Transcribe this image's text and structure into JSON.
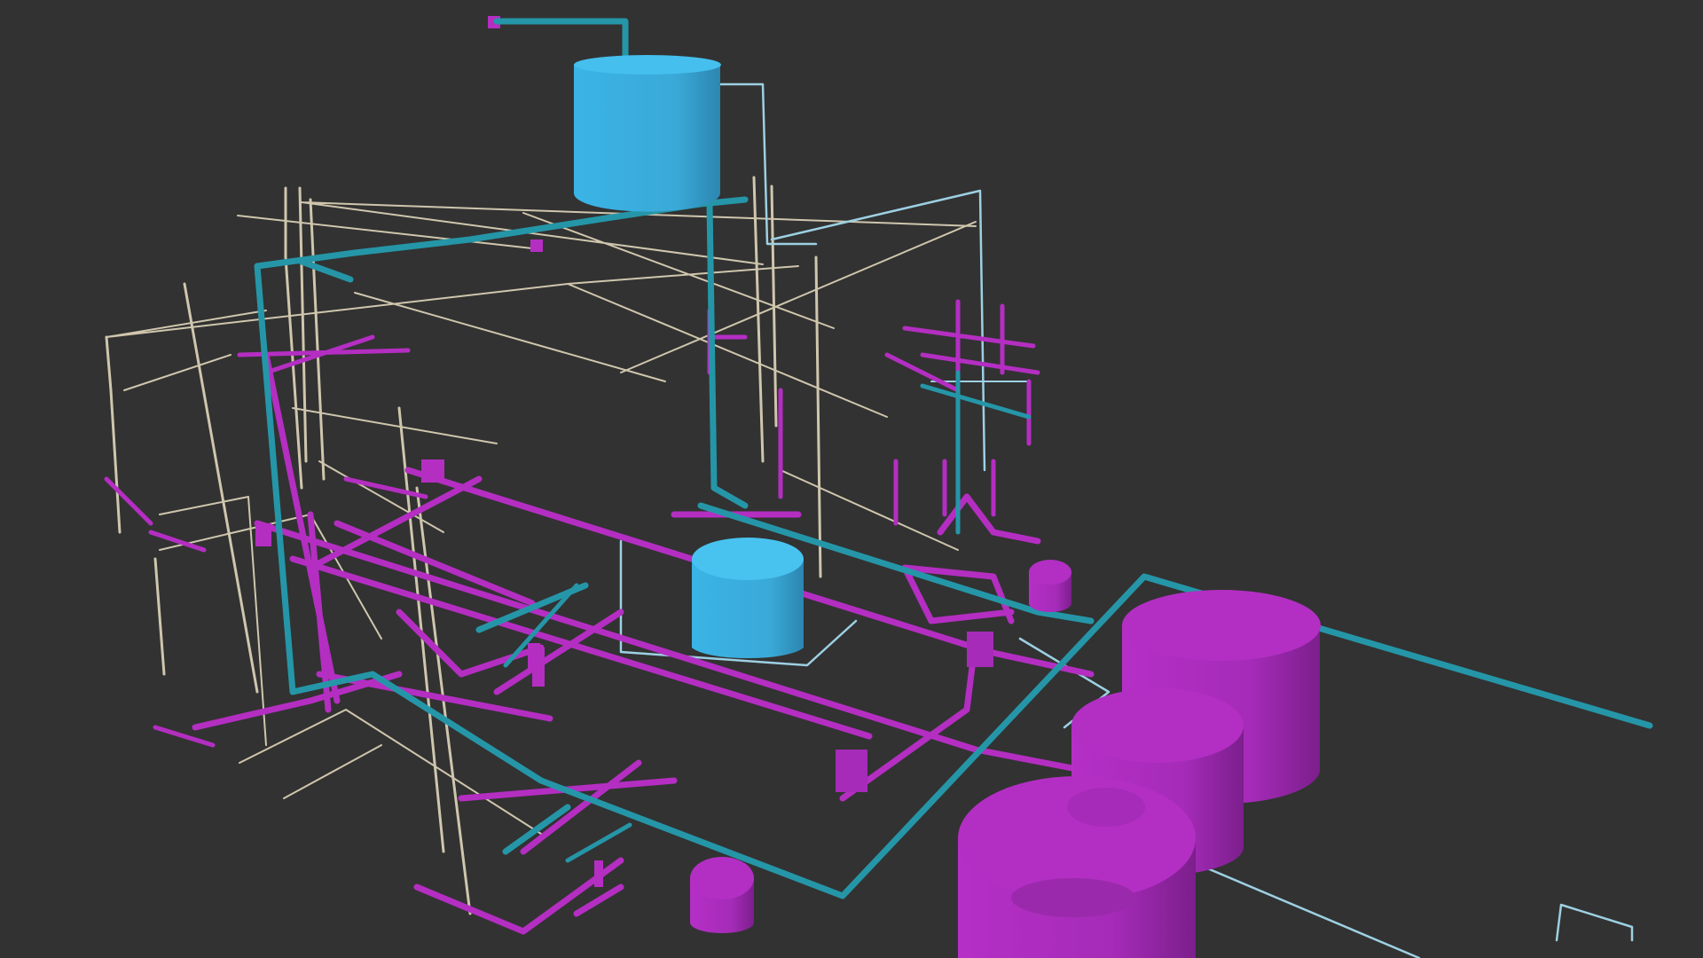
{
  "viewer": {
    "background_color": "#323232",
    "legend_colors": {
      "sanitary": "#b42ec2",
      "domestic_water": "#2596a8",
      "tank_blue": "#3aa9d8",
      "tank_magenta": "#a52bb8",
      "vent": "#cfc6ad",
      "cold_water": "#9dd0e2"
    }
  }
}
